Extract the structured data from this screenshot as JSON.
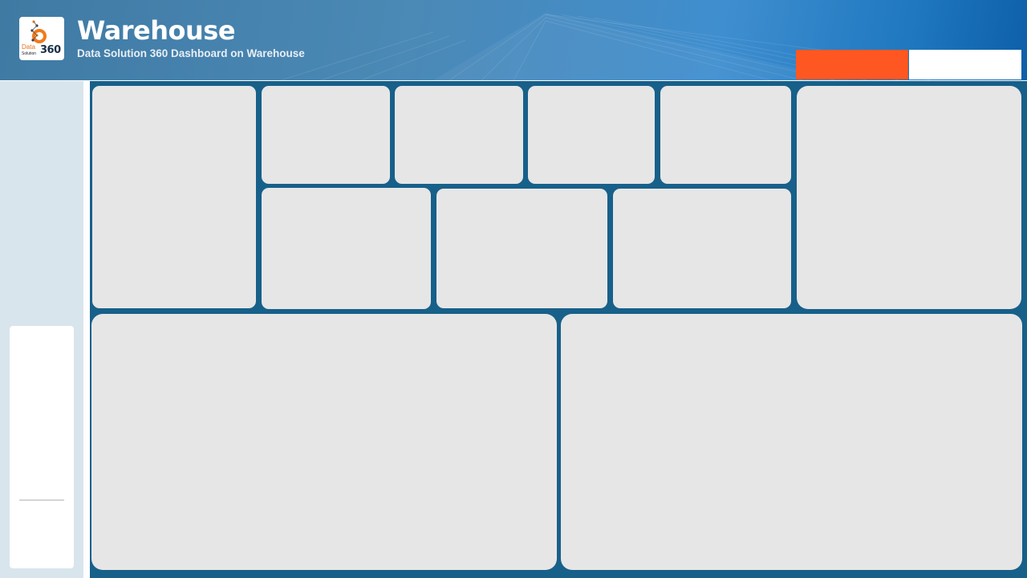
{
  "header": {
    "title": "Warehouse",
    "subtitle": "Data Solution 360 Dashboard on Warehouse",
    "logo": {
      "icon": "data-solution-360-logo",
      "word": "Data",
      "sub": "Solution",
      "number": "360"
    },
    "buttons": {
      "primary_color": "#ff5722",
      "secondary_color": "#ffffff"
    }
  },
  "colors": {
    "header_start": "#3f7aa3",
    "header_end": "#0d5fa8",
    "canvas": "#17608a",
    "card": "#e6e6e6",
    "sidebar": "#d8e5ec",
    "accent": "#ff5722"
  }
}
